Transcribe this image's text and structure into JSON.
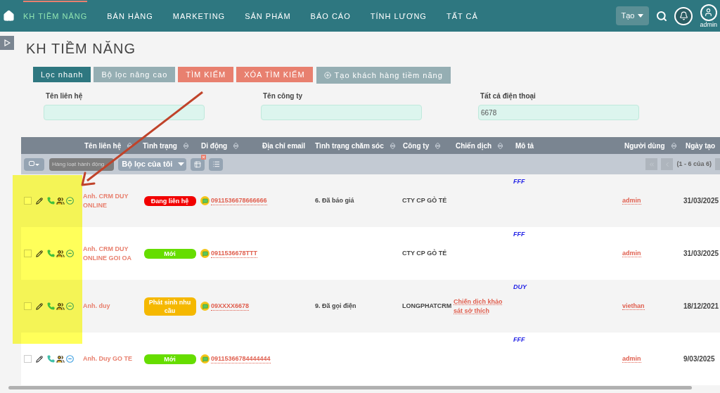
{
  "nav": {
    "items": [
      {
        "label": "KH TIỀM NĂNG",
        "selected": true
      },
      {
        "label": "BÁN HÀNG",
        "selected": false
      },
      {
        "label": "MARKETING",
        "selected": false
      },
      {
        "label": "SẢN PHẨM",
        "selected": false
      },
      {
        "label": "BÁO CÁO",
        "selected": false
      },
      {
        "label": "TÍNH LƯƠNG",
        "selected": false
      },
      {
        "label": "TẤT CẢ",
        "selected": false
      }
    ],
    "create_button": "Tạo",
    "user": "admin"
  },
  "title": "KH TIỀM NĂNG",
  "filter_tabs": [
    {
      "label": "Lọc nhanh",
      "kind": "tab",
      "selected": true
    },
    {
      "label": "Bộ lọc nâng cao",
      "kind": "tab",
      "selected": false
    },
    {
      "label": "TÌM KIẾM",
      "kind": "action"
    },
    {
      "label": "XÓA TÌM KIẾM",
      "kind": "action"
    },
    {
      "label": "Tạo khách hàng tiềm năng",
      "kind": "add"
    }
  ],
  "filters": [
    {
      "label": "Tên liên hệ"
    },
    {
      "label": "Tên công ty"
    },
    {
      "label": "Tất cả điện thoại",
      "value": "6678"
    }
  ],
  "table": {
    "columns": [
      {
        "label": "Tên liên hệ",
        "sortable": true
      },
      {
        "label": "Tình trạng",
        "sortable": true
      },
      {
        "label": "Di động",
        "sortable": true
      },
      {
        "label": "Địa chỉ email",
        "sortable": false
      },
      {
        "label": "Tình trạng chăm sóc",
        "sortable": true
      },
      {
        "label": "Công ty",
        "sortable": true
      },
      {
        "label": "Chiến dịch",
        "sortable": true
      },
      {
        "label": "Mô tả",
        "sortable": false
      },
      {
        "label": "Người dùng",
        "sortable": true
      },
      {
        "label": "Ngày tạo",
        "sortable": false
      }
    ],
    "toolbar": {
      "bulk_action": {
        "label": "Hàng loạt hành động",
        "disabled": true
      },
      "my_filter": "Bộ lọc của tôi",
      "pager": "(1 - 6 của 6)"
    },
    "rows": [
      {
        "checked": false,
        "name": "Anh. CRM DUY ONLINE",
        "status": {
          "label": "Đang liên hệ",
          "color": "#f20000"
        },
        "mobile": "0911536678666666",
        "care": "6. Đã báo giá",
        "company": "CTY CP GÒ TÉ",
        "description": "FFF",
        "user": "admin",
        "created": "31/03/2025"
      },
      {
        "checked": false,
        "name": "Anh. CRM DUY ONLINE GOI OA",
        "status": {
          "label": "Mới",
          "color": "#66dd00"
        },
        "mobile": "0911536678TTT",
        "company": "CTY CP GÒ TÉ",
        "description": "FFF",
        "user": "admin",
        "created": "31/03/2025"
      },
      {
        "checked": false,
        "name": "Anh. duy",
        "status": {
          "label": "Phát sinh nhu cầu",
          "color": "#f5b800"
        },
        "mobile": "09XXXX6678",
        "care": "9. Đã gọi điện",
        "company": "LONGPHATCRM",
        "campaign": "Chiến dịch khảo sát sở thích",
        "description": "DUY",
        "user": "viethan",
        "created": "18/12/2021"
      },
      {
        "checked": false,
        "name": "Anh. Duy GO TE",
        "status": {
          "label": "Mới",
          "color": "#66dd00"
        },
        "mobile": "09115366784444444",
        "description": "FFF",
        "user": "admin",
        "created": "9/03/2025"
      }
    ]
  }
}
